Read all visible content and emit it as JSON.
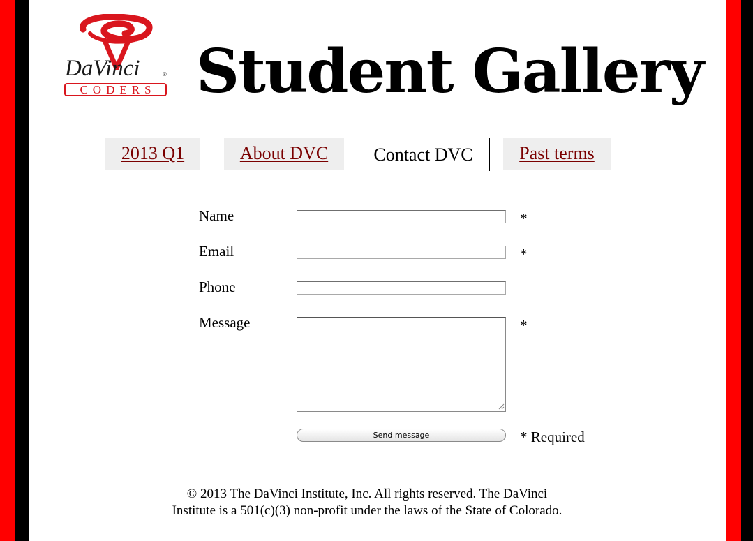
{
  "header": {
    "logo_word": "DaVinci",
    "logo_registered": "®",
    "logo_subtitle": "CODERS",
    "title": "Student Gallery"
  },
  "tabs": [
    {
      "label": "2013 Q1",
      "active": false
    },
    {
      "label": "About DVC",
      "active": false
    },
    {
      "label": "Contact DVC",
      "active": true
    },
    {
      "label": "Past terms",
      "active": false
    }
  ],
  "form": {
    "name_label": "Name",
    "email_label": "Email",
    "phone_label": "Phone",
    "message_label": "Message",
    "name_value": "",
    "email_value": "",
    "phone_value": "",
    "message_value": "",
    "required_mark": "*",
    "send_label": "Send message",
    "required_note": "* Required"
  },
  "footer": {
    "line1": "© 2013 The DaVinci Institute, Inc. All rights reserved. The DaVinci",
    "line2": "Institute is a 501(c)(3) non-profit under the laws of the State of Colorado."
  },
  "colors": {
    "frame_red": "#ff0000",
    "logo_red": "#d9161e",
    "link_color": "#7a0000",
    "tab_bg": "#eeeeee"
  },
  "icons": [
    "davinci-logo-icon",
    "textarea-resize-grip-icon"
  ]
}
